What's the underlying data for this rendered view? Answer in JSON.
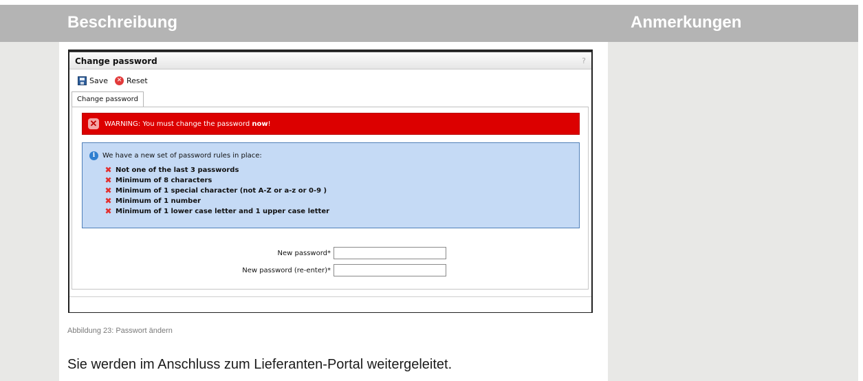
{
  "table": {
    "header_left": "Beschreibung",
    "header_right": "Anmerkungen"
  },
  "window": {
    "title": "Change password",
    "help": "?",
    "toolbar": {
      "save_label": "Save",
      "reset_label": "Reset"
    },
    "tab_label": "Change password",
    "warning": {
      "text": "WARNING: You must change the password ",
      "emphasis": "now",
      "suffix": "!"
    },
    "info": {
      "heading": "We have a new set of password rules in place:",
      "rules": [
        "Not one of the last 3 passwords",
        "Minimum of 8 characters",
        "Minimum of 1 special character (not A-Z or a-z or 0-9 )",
        "Minimum of 1 number",
        "Minimum of 1 lower case letter and 1 upper case letter"
      ]
    },
    "form": {
      "new_password_label": "New password*",
      "new_password_value": "",
      "reenter_label": "New password (re-enter)*",
      "reenter_value": ""
    }
  },
  "caption": "Abbildung 23: Passwort ändern",
  "sentence": "Sie werden im Anschluss zum Lieferanten-Portal weitergeleitet.",
  "icons": [
    "save-icon",
    "reset-icon",
    "error-icon",
    "info-icon"
  ]
}
